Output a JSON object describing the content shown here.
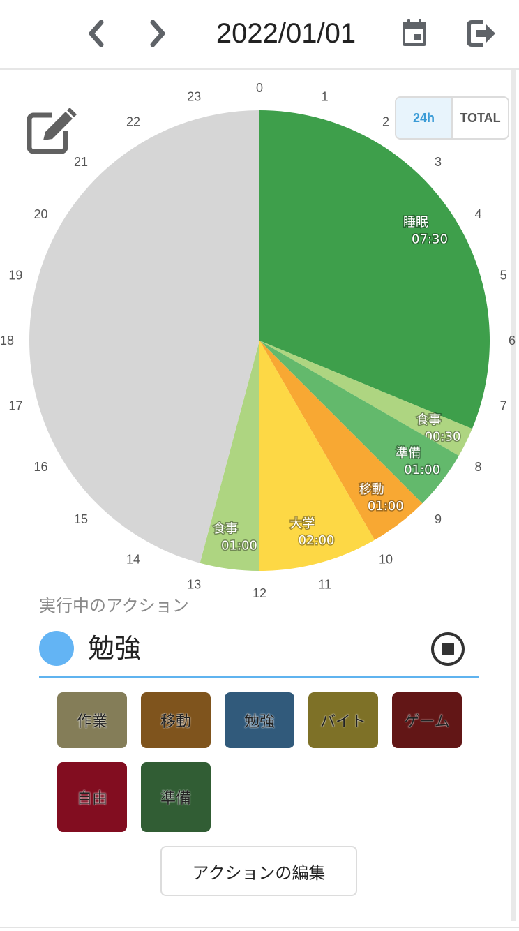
{
  "header": {
    "date": "2022/01/01",
    "prev_icon": "chevron-left-icon",
    "next_icon": "chevron-right-icon",
    "calendar_icon": "calendar-icon",
    "logout_icon": "logout-icon",
    "icon_color": "#5f6368"
  },
  "view_toggle": {
    "options": [
      "24h",
      "TOTAL"
    ],
    "selected": "24h"
  },
  "edit_icon": "edit-icon",
  "chart_data": {
    "type": "pie",
    "title": "",
    "hour_labels": [
      "0",
      "1",
      "2",
      "3",
      "4",
      "5",
      "6",
      "7",
      "8",
      "9",
      "10",
      "11",
      "12",
      "13",
      "14",
      "15",
      "16",
      "17",
      "18",
      "19",
      "20",
      "21",
      "22",
      "23"
    ],
    "series": [
      {
        "name": "睡眠",
        "label": "07:30",
        "hours": 7.5,
        "color": "#3e9f4b"
      },
      {
        "name": "食事",
        "label": "00:30",
        "hours": 0.5,
        "color": "#aed581"
      },
      {
        "name": "準備",
        "label": "01:00",
        "hours": 1.0,
        "color": "#63b96c"
      },
      {
        "name": "移動",
        "label": "01:00",
        "hours": 1.0,
        "color": "#f8a833"
      },
      {
        "name": "大学",
        "label": "02:00",
        "hours": 2.0,
        "color": "#fdd845"
      },
      {
        "name": "食事",
        "label": "01:00",
        "hours": 1.0,
        "color": "#aed581"
      },
      {
        "name": "",
        "label": "",
        "hours": 11.0,
        "color": "#d6d6d6"
      }
    ]
  },
  "running": {
    "label": "実行中のアクション",
    "name": "勉強",
    "color": "#63b4f4",
    "underline_color": "#5fb3ef",
    "stop_icon": "stop-icon"
  },
  "actions": [
    {
      "label": "作業",
      "color": "#847d58"
    },
    {
      "label": "移動",
      "color": "#7f541d"
    },
    {
      "label": "勉強",
      "color": "#315a7b"
    },
    {
      "label": "バイト",
      "color": "#7e7127"
    },
    {
      "label": "ゲーム",
      "color": "#621616"
    },
    {
      "label": "自由",
      "color": "#820d20"
    },
    {
      "label": "準備",
      "color": "#315d34"
    }
  ],
  "edit_actions_label": "アクションの編集"
}
